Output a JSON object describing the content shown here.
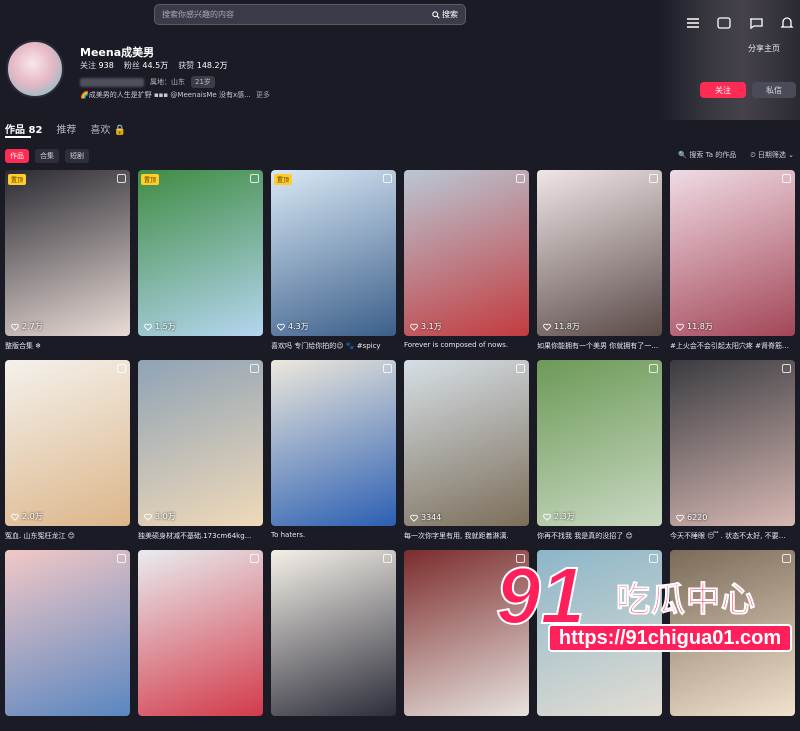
{
  "search": {
    "placeholder": "搜索你感兴趣的内容",
    "button_label": "搜索"
  },
  "profile": {
    "name": "Meena成美男",
    "following_label": "关注",
    "following_count": "938",
    "fans_label": "粉丝",
    "fans_count": "44.5万",
    "likes_label": "获赞",
    "likes_count": "148.2万",
    "location": "属地：山东",
    "age": "21岁",
    "bio": "🌈成美男的人生是扩野 ▪▪▪ @MeenaisMe 没有x感...",
    "more": "更多"
  },
  "actions": {
    "share": "分享主页",
    "follow": "关注",
    "message": "私信"
  },
  "tabs": [
    {
      "label": "作品 82"
    },
    {
      "label": "推荐"
    },
    {
      "label": "喜欢 🔒"
    }
  ],
  "chips": [
    "作品",
    "合集",
    "短剧"
  ],
  "tools": {
    "search_works": "🔍 搜索 Ta 的作品",
    "date_filter": "⏲ 日期筛选 ⌄"
  },
  "pin_label": "置顶",
  "videos": [
    {
      "likes": "2.7万",
      "caption": "整版合集 ❄",
      "pinned": true,
      "c1": "#2b2a33",
      "c2": "#e9dcd6"
    },
    {
      "likes": "1.5万",
      "caption": "",
      "pinned": true,
      "c1": "#3f8c43",
      "c2": "#b5d6f0"
    },
    {
      "likes": "4.3万",
      "caption": "喜欢吗 专门给你拍的😉 🐾 #spicy",
      "pinned": true,
      "c1": "#d9e8f5",
      "c2": "#3b5f8a"
    },
    {
      "likes": "3.1万",
      "caption": "Forever is composed of nows.",
      "pinned": false,
      "c1": "#b9c7d4",
      "c2": "#c23b3f"
    },
    {
      "likes": "11.8万",
      "caption": "如果你能拥有一个美男 你就拥有了一…",
      "pinned": false,
      "c1": "#efe6e6",
      "c2": "#5a4a48"
    },
    {
      "likes": "11.8万",
      "caption": "#上火会不会引起太阳穴疼 #肾脊筋…",
      "pinned": false,
      "c1": "#efdbe4",
      "c2": "#a34657"
    },
    {
      "likes": "2.0万",
      "caption": "冤血. 山东冤枉龙江 😊",
      "pinned": false,
      "c1": "#f4f1ec",
      "c2": "#dcb68a"
    },
    {
      "likes": "3.0万",
      "caption": "独美硕身材减不基础.173cm64kg...",
      "pinned": false,
      "c1": "#8fa3b5",
      "c2": "#f0d9b9"
    },
    {
      "likes": "",
      "caption": "To haters.",
      "pinned": false,
      "c1": "#ede8dc",
      "c2": "#2b5fb3"
    },
    {
      "likes": "3344",
      "caption": "每一次你字里有用, 我就距着淋漓.",
      "pinned": false,
      "c1": "#d6dfe6",
      "c2": "#7c6e5a"
    },
    {
      "likes": "2.3万",
      "caption": "你再不找我 我是真的没招了 😊",
      "pinned": false,
      "c1": "#6c9a57",
      "c2": "#c9d8c2"
    },
    {
      "likes": "6220",
      "caption": "今天不睡眼 😴 . 状态不太好, 不要…",
      "pinned": false,
      "c1": "#3a3b40",
      "c2": "#d7b8b3"
    },
    {
      "likes": "",
      "caption": "",
      "pinned": false,
      "c1": "#f2c8c6",
      "c2": "#5a86c0"
    },
    {
      "likes": "",
      "caption": "",
      "pinned": false,
      "c1": "#e8ecef",
      "c2": "#d33a4a"
    },
    {
      "likes": "",
      "caption": "",
      "pinned": false,
      "c1": "#f5f0e8",
      "c2": "#2c2d3a"
    },
    {
      "likes": "",
      "caption": "",
      "pinned": false,
      "c1": "#7b2c2c",
      "c2": "#e7e2de"
    },
    {
      "likes": "",
      "caption": "",
      "pinned": false,
      "c1": "#8cb6c9",
      "c2": "#e2ddd3"
    },
    {
      "likes": "",
      "caption": "",
      "pinned": false,
      "c1": "#7a6a58",
      "c2": "#f1e2cd"
    }
  ],
  "watermark": {
    "number": "91",
    "cn": "吃瓜中心",
    "url": "https://91chigua01.com"
  }
}
